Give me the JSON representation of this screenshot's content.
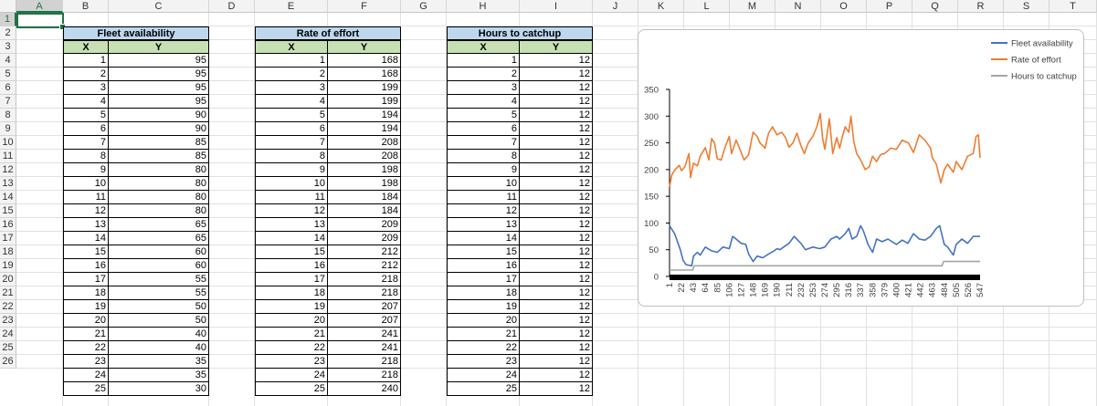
{
  "columns": [
    "A",
    "B",
    "C",
    "D",
    "E",
    "F",
    "G",
    "H",
    "I",
    "J",
    "K",
    "L",
    "M",
    "N",
    "O",
    "P",
    "Q",
    "R",
    "S",
    "T"
  ],
  "rows": [
    1,
    2,
    3,
    4,
    5,
    6,
    7,
    8,
    9,
    10,
    11,
    12,
    13,
    14,
    15,
    16,
    17,
    18,
    19,
    20,
    21,
    22,
    23,
    24,
    25,
    26
  ],
  "selected_cell": "A1",
  "tables": [
    {
      "title": "Fleet availability",
      "x_label": "X",
      "y_label": "Y",
      "x": [
        1,
        2,
        3,
        4,
        5,
        6,
        7,
        8,
        9,
        10,
        11,
        12,
        13,
        14,
        15,
        16,
        17,
        18,
        19,
        20,
        21,
        22,
        23,
        24,
        25
      ],
      "y": [
        95,
        95,
        95,
        95,
        90,
        90,
        85,
        85,
        80,
        80,
        80,
        80,
        65,
        65,
        60,
        60,
        55,
        55,
        50,
        50,
        40,
        40,
        35,
        35,
        30
      ]
    },
    {
      "title": "Rate of effort",
      "x_label": "X",
      "y_label": "Y",
      "x": [
        1,
        2,
        3,
        4,
        5,
        6,
        7,
        8,
        9,
        10,
        11,
        12,
        13,
        14,
        15,
        16,
        17,
        18,
        19,
        20,
        21,
        22,
        23,
        24,
        25
      ],
      "y": [
        168,
        168,
        199,
        199,
        194,
        194,
        208,
        208,
        198,
        198,
        184,
        184,
        209,
        209,
        212,
        212,
        218,
        218,
        207,
        207,
        241,
        241,
        218,
        218,
        240
      ]
    },
    {
      "title": "Hours to catchup",
      "x_label": "X",
      "y_label": "Y",
      "x": [
        1,
        2,
        3,
        4,
        5,
        6,
        7,
        8,
        9,
        10,
        11,
        12,
        13,
        14,
        15,
        16,
        17,
        18,
        19,
        20,
        21,
        22,
        23,
        24,
        25
      ],
      "y": [
        12,
        12,
        12,
        12,
        12,
        12,
        12,
        12,
        12,
        12,
        12,
        12,
        12,
        12,
        12,
        12,
        12,
        12,
        12,
        12,
        12,
        12,
        12,
        12,
        12
      ]
    }
  ],
  "chart_data": {
    "type": "line",
    "title": "",
    "xlabel": "",
    "ylabel": "",
    "ylim": [
      0,
      350
    ],
    "yticks": [
      0,
      50,
      100,
      150,
      200,
      250,
      300,
      350
    ],
    "xlim": [
      1,
      547
    ],
    "x_tick_labels": [
      "1",
      "22",
      "43",
      "64",
      "85",
      "106",
      "127",
      "148",
      "169",
      "190",
      "211",
      "232",
      "253",
      "274",
      "295",
      "316",
      "337",
      "358",
      "379",
      "400",
      "421",
      "442",
      "463",
      "484",
      "505",
      "526",
      "547"
    ],
    "legend_position": "top-right",
    "grid": false,
    "series": [
      {
        "name": "Fleet availability",
        "color": "#4472c4",
        "points": [
          [
            1,
            95
          ],
          [
            10,
            80
          ],
          [
            20,
            50
          ],
          [
            25,
            30
          ],
          [
            30,
            22
          ],
          [
            40,
            20
          ],
          [
            43,
            38
          ],
          [
            50,
            45
          ],
          [
            55,
            40
          ],
          [
            64,
            55
          ],
          [
            75,
            48
          ],
          [
            85,
            45
          ],
          [
            95,
            55
          ],
          [
            106,
            52
          ],
          [
            112,
            75
          ],
          [
            118,
            70
          ],
          [
            127,
            62
          ],
          [
            135,
            60
          ],
          [
            140,
            42
          ],
          [
            148,
            28
          ],
          [
            155,
            38
          ],
          [
            165,
            35
          ],
          [
            175,
            42
          ],
          [
            185,
            48
          ],
          [
            190,
            52
          ],
          [
            195,
            50
          ],
          [
            211,
            62
          ],
          [
            220,
            75
          ],
          [
            232,
            62
          ],
          [
            240,
            50
          ],
          [
            253,
            55
          ],
          [
            265,
            52
          ],
          [
            274,
            55
          ],
          [
            285,
            70
          ],
          [
            295,
            75
          ],
          [
            300,
            70
          ],
          [
            310,
            80
          ],
          [
            316,
            90
          ],
          [
            322,
            70
          ],
          [
            330,
            75
          ],
          [
            337,
            95
          ],
          [
            342,
            85
          ],
          [
            350,
            60
          ],
          [
            358,
            45
          ],
          [
            365,
            70
          ],
          [
            375,
            65
          ],
          [
            385,
            70
          ],
          [
            400,
            60
          ],
          [
            410,
            68
          ],
          [
            420,
            62
          ],
          [
            430,
            80
          ],
          [
            440,
            70
          ],
          [
            450,
            68
          ],
          [
            460,
            75
          ],
          [
            470,
            90
          ],
          [
            476,
            95
          ],
          [
            484,
            60
          ],
          [
            490,
            55
          ],
          [
            500,
            40
          ],
          [
            505,
            60
          ],
          [
            515,
            70
          ],
          [
            525,
            62
          ],
          [
            535,
            75
          ],
          [
            547,
            75
          ]
        ]
      },
      {
        "name": "Rate of effort",
        "color": "#ed7d31",
        "points": [
          [
            1,
            168
          ],
          [
            5,
            190
          ],
          [
            10,
            199
          ],
          [
            18,
            208
          ],
          [
            22,
            198
          ],
          [
            28,
            205
          ],
          [
            35,
            230
          ],
          [
            38,
            185
          ],
          [
            43,
            212
          ],
          [
            50,
            207
          ],
          [
            55,
            225
          ],
          [
            64,
            241
          ],
          [
            70,
            218
          ],
          [
            75,
            258
          ],
          [
            80,
            250
          ],
          [
            85,
            220
          ],
          [
            92,
            218
          ],
          [
            98,
            240
          ],
          [
            106,
            262
          ],
          [
            110,
            230
          ],
          [
            118,
            255
          ],
          [
            127,
            232
          ],
          [
            132,
            218
          ],
          [
            140,
            228
          ],
          [
            148,
            270
          ],
          [
            155,
            262
          ],
          [
            160,
            250
          ],
          [
            169,
            240
          ],
          [
            175,
            268
          ],
          [
            182,
            280
          ],
          [
            190,
            265
          ],
          [
            198,
            270
          ],
          [
            205,
            260
          ],
          [
            211,
            242
          ],
          [
            218,
            250
          ],
          [
            225,
            268
          ],
          [
            232,
            245
          ],
          [
            238,
            230
          ],
          [
            245,
            250
          ],
          [
            253,
            262
          ],
          [
            260,
            280
          ],
          [
            266,
            305
          ],
          [
            270,
            260
          ],
          [
            274,
            238
          ],
          [
            282,
            295
          ],
          [
            288,
            230
          ],
          [
            295,
            260
          ],
          [
            300,
            240
          ],
          [
            305,
            262
          ],
          [
            310,
            280
          ],
          [
            316,
            270
          ],
          [
            320,
            300
          ],
          [
            325,
            252
          ],
          [
            330,
            230
          ],
          [
            337,
            218
          ],
          [
            345,
            200
          ],
          [
            352,
            205
          ],
          [
            358,
            225
          ],
          [
            365,
            215
          ],
          [
            372,
            228
          ],
          [
            379,
            230
          ],
          [
            390,
            240
          ],
          [
            400,
            238
          ],
          [
            410,
            255
          ],
          [
            421,
            250
          ],
          [
            430,
            232
          ],
          [
            440,
            265
          ],
          [
            450,
            255
          ],
          [
            460,
            240
          ],
          [
            463,
            222
          ],
          [
            470,
            210
          ],
          [
            478,
            175
          ],
          [
            484,
            200
          ],
          [
            490,
            210
          ],
          [
            500,
            195
          ],
          [
            505,
            215
          ],
          [
            515,
            200
          ],
          [
            525,
            225
          ],
          [
            535,
            230
          ],
          [
            540,
            262
          ],
          [
            544,
            265
          ],
          [
            547,
            222
          ]
        ]
      },
      {
        "name": "Hours to catchup",
        "color": "#a5a5a5",
        "points": [
          [
            1,
            12
          ],
          [
            40,
            12
          ],
          [
            42,
            12
          ],
          [
            44,
            20
          ],
          [
            480,
            20
          ],
          [
            483,
            28
          ],
          [
            547,
            28
          ]
        ]
      }
    ]
  }
}
